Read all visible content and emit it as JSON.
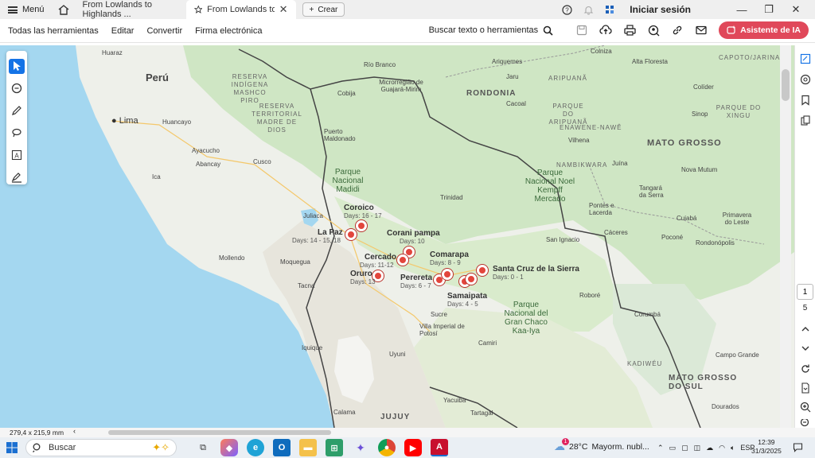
{
  "titlebar": {
    "menu_label": "Menú",
    "tabs": [
      {
        "label": "From Lowlands to Highlands ..."
      },
      {
        "label": "From Lowlands to Highl..."
      }
    ],
    "new_tab_label": "Crear",
    "signin_label": "Iniciar sesión"
  },
  "toolbar": {
    "items": [
      "Todas las herramientas",
      "Editar",
      "Convertir",
      "Firma electrónica"
    ],
    "search_label": "Buscar texto o herramientas",
    "ai_button": "Asistente de IA"
  },
  "map": {
    "countries": [
      "Perú"
    ],
    "regions": [
      "RONDONIA",
      "MATO GROSSO",
      "MATO GROSSO DO SUL",
      "JUJUY",
      "CAPOTO/JARINA",
      "PARQUE DO XINGU",
      "PARQUE DO ARIPUANÃ",
      "ARIPUANÃ",
      "ENAWENE-NAWÊ",
      "NAMBIKWARA",
      "KADIWÉU"
    ],
    "reserves": [
      "RESERVA INDÍGENA MASHCO PIRO",
      "RESERVA TERRITORIAL MADRE DE DIOS"
    ],
    "parks": [
      "Parque Nacional Madidi",
      "Parque Nacional Noel Kempff Mercado",
      "Parque Nacional del Gran Chaco Kaa-Iya"
    ],
    "cities": [
      "Lima",
      "Huancayo",
      "Ayacucho",
      "Abancay",
      "Cusco",
      "Ica",
      "Juliaca",
      "Mollendo",
      "Moquegua",
      "Tacna",
      "Iquique",
      "Calama",
      "Oruro",
      "Sucre",
      "Villa Imperial de Potosí",
      "Uyuni",
      "Camiri",
      "Yacuiba",
      "Tartagal",
      "Trinidad",
      "Cobija",
      "Puerto Maldonado",
      "Río Branco",
      "Microrregião de Guajará-Mirim",
      "Cacoal",
      "Vilhena",
      "Ariquemes",
      "Jaru",
      "Colíder",
      "Sinop",
      "Alta Floresta",
      "Colniza",
      "Juína",
      "Nova Mutum",
      "Tangará da Serra",
      "Pontes e Lacerda",
      "Cáceres",
      "Cuiabá",
      "Poconé",
      "Primavera do Leste",
      "Rondonópolis",
      "San Ignacio",
      "Roboré",
      "Corumbá",
      "Campo Grande",
      "Dourados",
      "Huaraz"
    ],
    "stops": [
      {
        "name": "Coroico",
        "days": "Days: 16 - 17"
      },
      {
        "name": "La Paz",
        "days": "Days: 14 - 15, 18"
      },
      {
        "name": "Corani pampa",
        "days": "Days: 10"
      },
      {
        "name": "Cercado",
        "days": "Days: 11-12"
      },
      {
        "name": "Comarapa",
        "days": "Days: 8 - 9"
      },
      {
        "name": "Oruro",
        "days": "Days: 13"
      },
      {
        "name": "Perereta",
        "days": "Days: 6 - 7"
      },
      {
        "name": "Santa Cruz de la Sierra",
        "days": "Days: 0 - 1"
      },
      {
        "name": "Samaipata",
        "days": "Days: 4 - 5"
      }
    ]
  },
  "rightpanel": {
    "page_current": "1",
    "page_total": "5"
  },
  "statusbar": {
    "dimensions": "279,4 x 215,9 mm"
  },
  "taskbar": {
    "search_placeholder": "Buscar",
    "weather_temp": "28°C",
    "weather_desc": "Mayorm. nubl...",
    "lang": "ESP",
    "time": "12:39",
    "date": "31/3/2025",
    "weather_badge": "1"
  }
}
